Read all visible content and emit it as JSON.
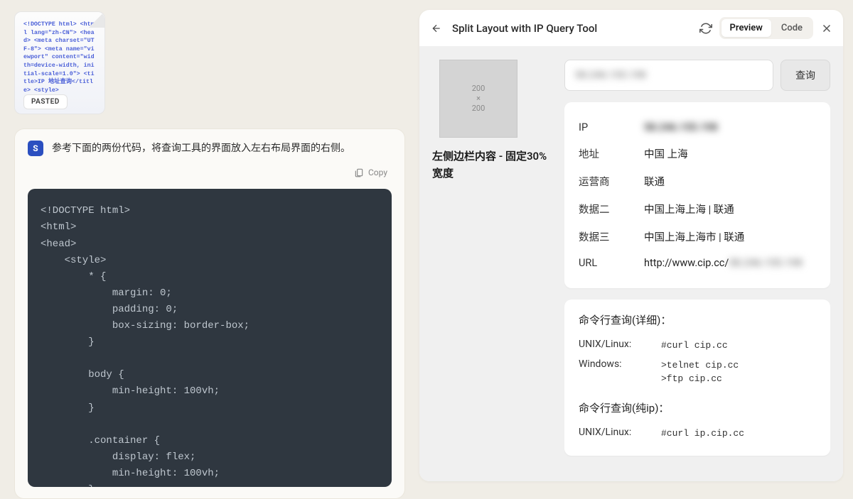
{
  "attachment": {
    "badge": "PASTED",
    "code_preview": "<!DOCTYPE html> <html lang=\"zh-CN\"> <head> <meta charset=\"UTF-8\"> <meta name=\"viewport\" content=\"width=device-width, initial-scale=1.0\"> <title>IP 地址查询</title> <style>"
  },
  "prompt": {
    "avatar_letter": "S",
    "text": "参考下面的两份代码，将查询工具的界面放入左右布局界面的右侧。"
  },
  "copy_label": "Copy",
  "code": "<!DOCTYPE html>\n<html>\n<head>\n    <style>\n        * {\n            margin: 0;\n            padding: 0;\n            box-sizing: border-box;\n        }\n\n        body {\n            min-height: 100vh;\n        }\n\n        .container {\n            display: flex;\n            min-height: 100vh;\n        }",
  "panel": {
    "title": "Split Layout with IP Query Tool",
    "tabs": {
      "preview": "Preview",
      "code": "Code"
    }
  },
  "layout": {
    "left_placeholder": {
      "w": "200",
      "x": "×",
      "h": "200"
    },
    "left_text": "左侧边栏内容 - 固定30%宽度",
    "query_input_value": "58.246.155.198",
    "query_btn": "查询",
    "info": {
      "ip_label": "IP",
      "ip_value": "58.246.155.198",
      "addr_label": "地址",
      "addr_value": "中国 上海",
      "isp_label": "运营商",
      "isp_value": "联通",
      "d2_label": "数据二",
      "d2_value": "中国上海上海 | 联通",
      "d3_label": "数据三",
      "d3_value": "中国上海上海市 | 联通",
      "url_label": "URL",
      "url_prefix": "http://www.cip.cc/",
      "url_suffix": "58.246.155.198"
    },
    "cmd": {
      "title1": "命令行查询(详细)：",
      "unix_label": "UNIX/Linux:",
      "unix_val1": "#curl cip.cc",
      "win_label": "Windows:",
      "win_val": ">telnet cip.cc\n>ftp cip.cc",
      "title2": "命令行查询(纯ip)：",
      "unix_val2": "#curl ip.cip.cc"
    }
  }
}
